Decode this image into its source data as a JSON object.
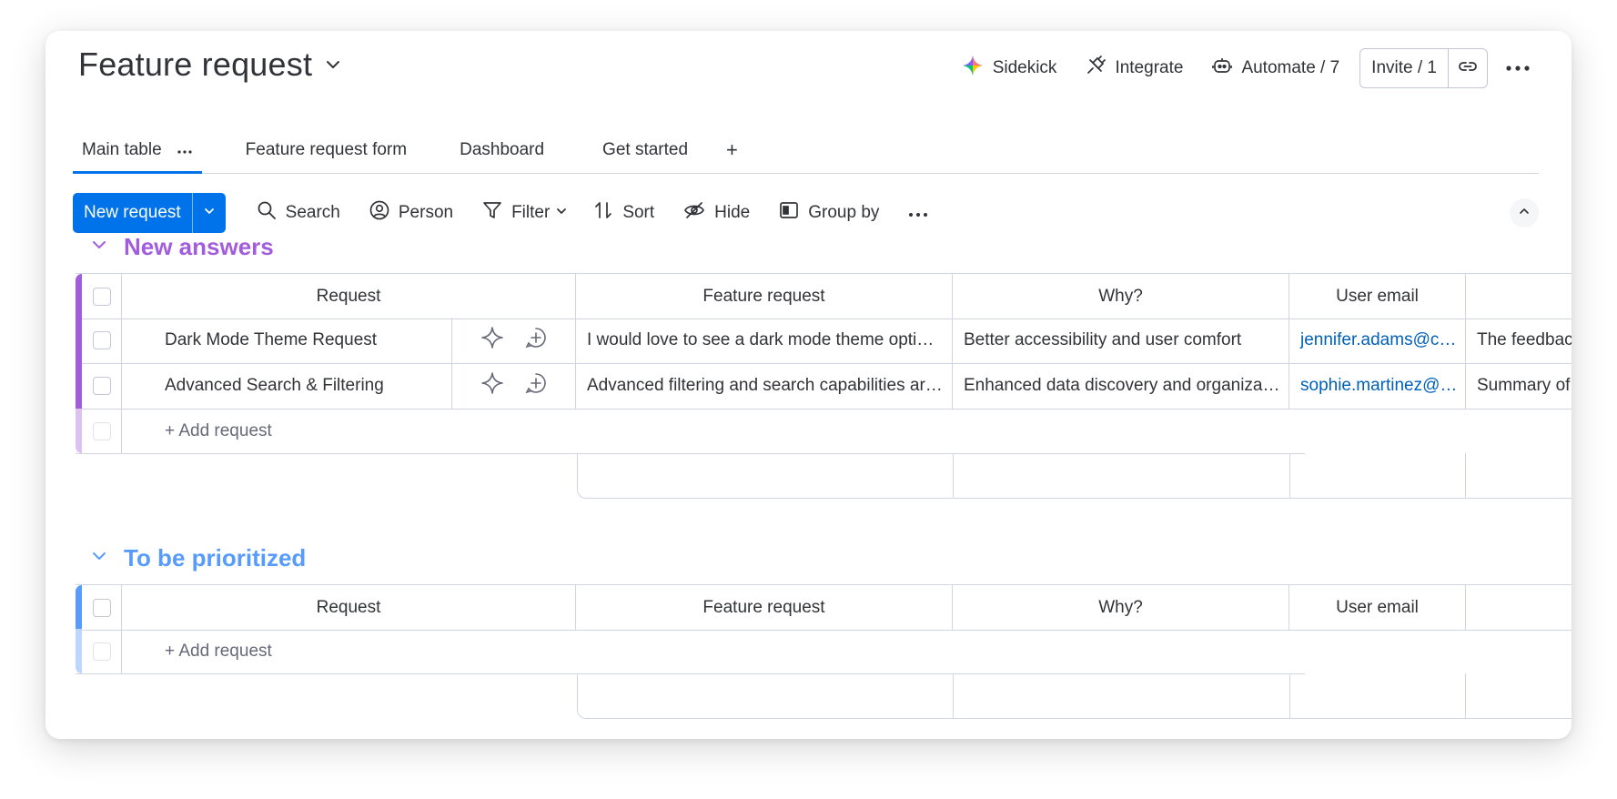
{
  "header": {
    "title": "Feature request",
    "sidekick_label": "Sidekick",
    "integrate_label": "Integrate",
    "automate_label": "Automate / 7",
    "invite_label": "Invite / 1"
  },
  "tabs": [
    {
      "label": "Main table"
    },
    {
      "label": "Feature request form"
    },
    {
      "label": "Dashboard"
    },
    {
      "label": "Get started"
    }
  ],
  "toolbar": {
    "new_request_label": "New request",
    "search_label": "Search",
    "person_label": "Person",
    "filter_label": "Filter",
    "sort_label": "Sort",
    "hide_label": "Hide",
    "group_by_label": "Group by"
  },
  "columns": [
    "Request",
    "Feature request",
    "Why?",
    "User email"
  ],
  "groups": [
    {
      "title": "New answers",
      "color": "#a25ddc",
      "light_color": "#dcc2f1",
      "rows": [
        {
          "request": "Dark Mode Theme Request",
          "feature_request": "I would love to see a dark mode theme opti…",
          "why": "Better accessibility and user comfort",
          "email": "jennifer.adams@c…",
          "summary": "The feedbac"
        },
        {
          "request": "Advanced Search & Filtering",
          "feature_request": "Advanced filtering and search capabilities ar…",
          "why": "Enhanced data discovery and organiza…",
          "email": "sophie.martinez@…",
          "summary": "Summary of"
        }
      ],
      "add_label": "+ Add request"
    },
    {
      "title": "To be prioritized",
      "color": "#579bfc",
      "light_color": "#bcd6fd",
      "rows": [],
      "add_label": "+ Add request"
    }
  ]
}
